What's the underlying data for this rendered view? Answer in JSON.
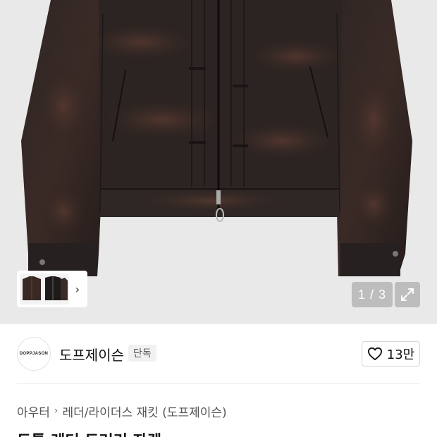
{
  "gallery": {
    "pager_text": "1 / 3",
    "expand_icon": "expand-icon",
    "thumb_chevron": "›"
  },
  "brand": {
    "logo_text": "DOPPJASON",
    "name": "도프제이슨",
    "badge": "단독",
    "like_count": "13만"
  },
  "breadcrumb": {
    "items": [
      "아우터",
      "레더/라이더스 재킷 (도프제이슨)"
    ]
  },
  "product": {
    "title": "도톰 레더 트러커 자켓"
  },
  "colors": {
    "hero_bg": "#e9e9e9",
    "leather": "#2a2220"
  }
}
